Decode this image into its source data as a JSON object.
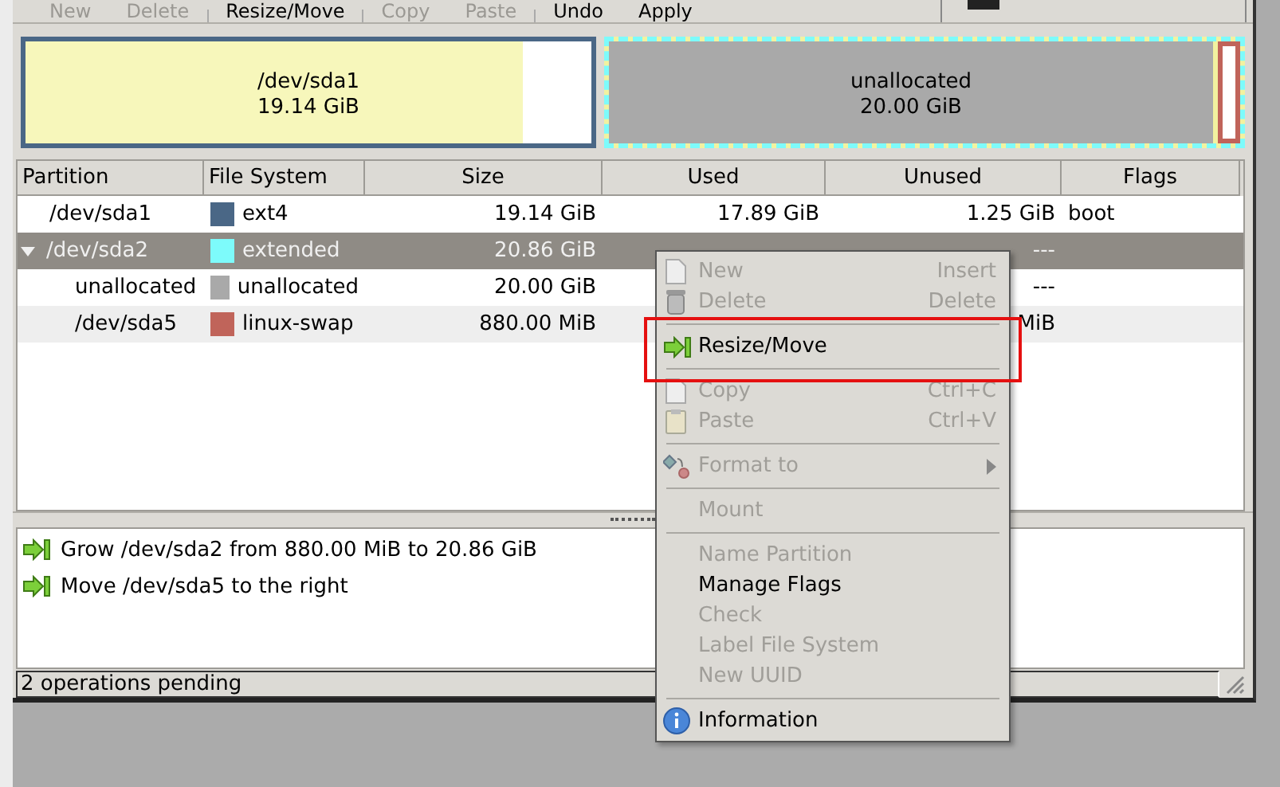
{
  "toolbar": [
    {
      "label": "New",
      "disabled": true
    },
    {
      "label": "Delete",
      "disabled": true
    },
    {
      "label": "Resize/Move",
      "disabled": false
    },
    {
      "label": "Copy",
      "disabled": true
    },
    {
      "label": "Paste",
      "disabled": true
    },
    {
      "label": "Undo",
      "disabled": false
    },
    {
      "label": "Apply",
      "disabled": false
    }
  ],
  "disk_map": {
    "primary": {
      "name": "/dev/sda1",
      "size": "19.14 GiB",
      "color": "#4a6786",
      "level": 0.88
    },
    "extended": {
      "color": "#7dfbfb",
      "unallocated": {
        "name": "unallocated",
        "size": "20.00 GiB",
        "color": "#a9a9a9"
      },
      "swap": {
        "color": "#c0645a"
      }
    }
  },
  "table": {
    "columns": [
      "Partition",
      "File System",
      "Size",
      "Used",
      "Unused",
      "Flags"
    ],
    "rows": [
      {
        "partition": "/dev/sda1",
        "filesystem": "ext4",
        "color": "#4a6786",
        "size": "19.14 GiB",
        "used": "17.89 GiB",
        "unused": "1.25 GiB",
        "flags": "boot",
        "selected": false
      },
      {
        "partition": "/dev/sda2",
        "filesystem": "extended",
        "color": "#7dfbfb",
        "size": "20.86 GiB",
        "unused": "---",
        "selected": true,
        "expanded": true,
        "children": [
          {
            "partition": "unallocated",
            "filesystem": "unallocated",
            "color": "#a9a9a9",
            "size": "20.00 GiB",
            "unused": "---",
            "selected": false
          },
          {
            "partition": "/dev/sda5",
            "filesystem": "linux-swap",
            "color": "#c0645a",
            "size": "880.00 MiB",
            "unused": "MiB",
            "selected": false
          }
        ]
      }
    ]
  },
  "operations": [
    "Grow /dev/sda2 from 880.00 MiB to 20.86 GiB",
    "Move /dev/sda5 to the right"
  ],
  "status_bar": "2 operations pending",
  "context_menu": [
    {
      "kind": "item",
      "label": "New",
      "shortcut": "Insert",
      "disabled": true
    },
    {
      "kind": "item",
      "label": "Delete",
      "shortcut": "Delete",
      "disabled": true
    },
    {
      "kind": "separator"
    },
    {
      "kind": "item",
      "label": "Resize/Move",
      "disabled": false,
      "highlighted": true
    },
    {
      "kind": "separator"
    },
    {
      "kind": "item",
      "label": "Copy",
      "shortcut": "Ctrl+C",
      "disabled": true
    },
    {
      "kind": "item",
      "label": "Paste",
      "shortcut": "Ctrl+V",
      "disabled": true
    },
    {
      "kind": "separator"
    },
    {
      "kind": "item",
      "label": "Format to",
      "disabled": true,
      "submenu": true
    },
    {
      "kind": "separator"
    },
    {
      "kind": "item",
      "label": "Mount",
      "disabled": true
    },
    {
      "kind": "separator"
    },
    {
      "kind": "item",
      "label": "Name Partition",
      "disabled": true
    },
    {
      "kind": "item",
      "label": "Manage Flags",
      "disabled": false
    },
    {
      "kind": "item",
      "label": "Check",
      "disabled": true
    },
    {
      "kind": "item",
      "label": "Label File System",
      "disabled": true
    },
    {
      "kind": "item",
      "label": "New UUID",
      "disabled": true
    },
    {
      "kind": "separator"
    },
    {
      "kind": "item",
      "label": "Information",
      "disabled": false
    }
  ]
}
